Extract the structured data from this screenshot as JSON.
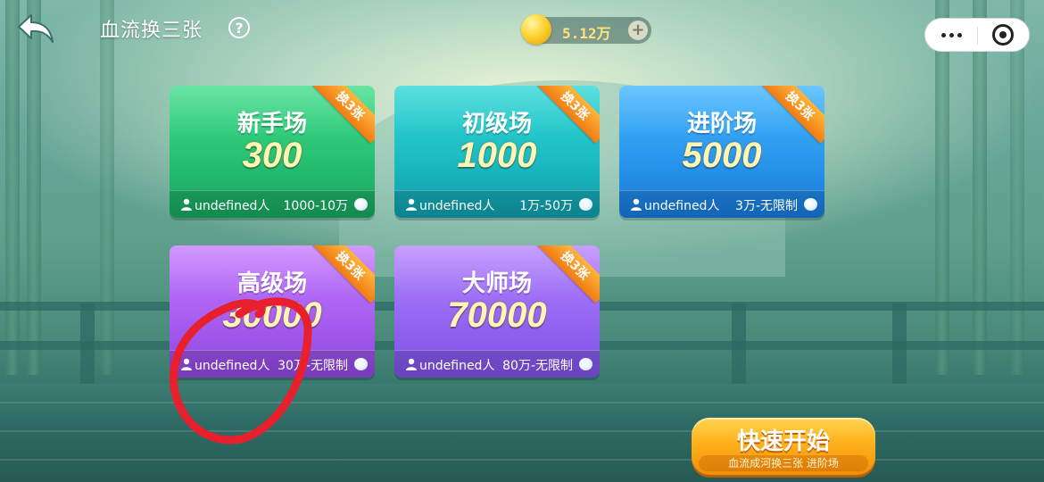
{
  "header": {
    "title": "血流换三张",
    "help_symbol": "?",
    "coins": "5.12万",
    "add_symbol": "+"
  },
  "rooms": [
    {
      "name": "新手场",
      "stake": "300",
      "players": "undefined人",
      "range": "1000-10万",
      "badge": "换3张",
      "theme": "green"
    },
    {
      "name": "初级场",
      "stake": "1000",
      "players": "undefined人",
      "range": "1万-50万",
      "badge": "换3张",
      "theme": "teal"
    },
    {
      "name": "进阶场",
      "stake": "5000",
      "players": "undefined人",
      "range": "3万-无限制",
      "badge": "换3张",
      "theme": "blue"
    },
    {
      "name": "高级场",
      "stake": "30000",
      "players": "undefined人",
      "range": "30万-无限制",
      "badge": "换3张",
      "theme": "purple"
    },
    {
      "name": "大师场",
      "stake": "70000",
      "players": "undefined人",
      "range": "80万-无限制",
      "badge": "换3张",
      "theme": "violet"
    }
  ],
  "quick_start": {
    "label": "快速开始",
    "sub_label": "血流成河换三张 进阶场"
  },
  "icons": {
    "back": "back-arrow-icon",
    "help": "question-icon",
    "coin": "gold-coin-icon",
    "more": "more-dots-icon",
    "close": "target-close-icon",
    "person": "person-icon",
    "jade": "jade-icon"
  },
  "colors": {
    "annotation": "#e81f2c",
    "stake_text": "#fff6b5",
    "quick_button": "#ffb11c"
  }
}
